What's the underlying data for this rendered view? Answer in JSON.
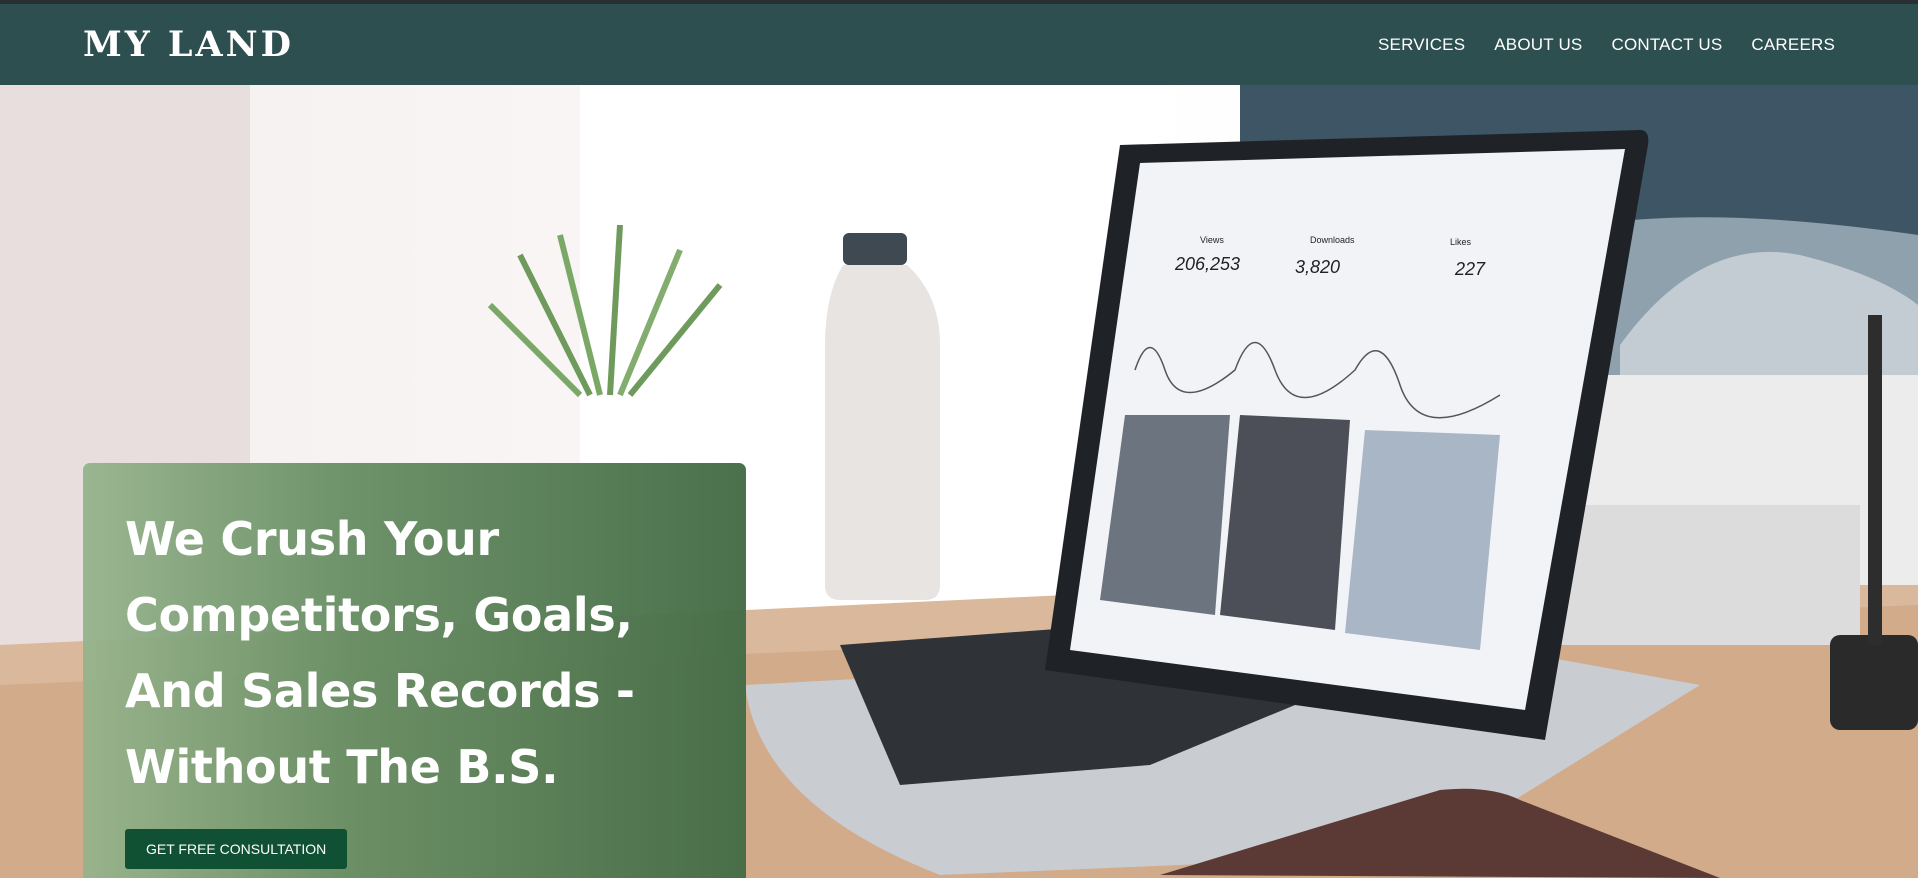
{
  "brand": {
    "name": "MY LAND"
  },
  "nav": {
    "items": [
      {
        "label": "SERVICES"
      },
      {
        "label": "ABOUT US"
      },
      {
        "label": "CONTACT US"
      },
      {
        "label": "CAREERS"
      }
    ]
  },
  "hero": {
    "title": "We Crush Your Competitors, Goals, And Sales Records - Without The B.S.",
    "cta_label": "GET FREE CONSULTATION"
  },
  "laptop_screen": {
    "stats": [
      {
        "label": "Views",
        "value": "206,253"
      },
      {
        "label": "Downloads",
        "value": "3,820"
      },
      {
        "label": "Likes",
        "value": "227"
      }
    ]
  },
  "colors": {
    "navbar": "#2e4f4f",
    "card_start": "#96b48c",
    "card_end": "#446c46",
    "cta": "#0f5132"
  }
}
